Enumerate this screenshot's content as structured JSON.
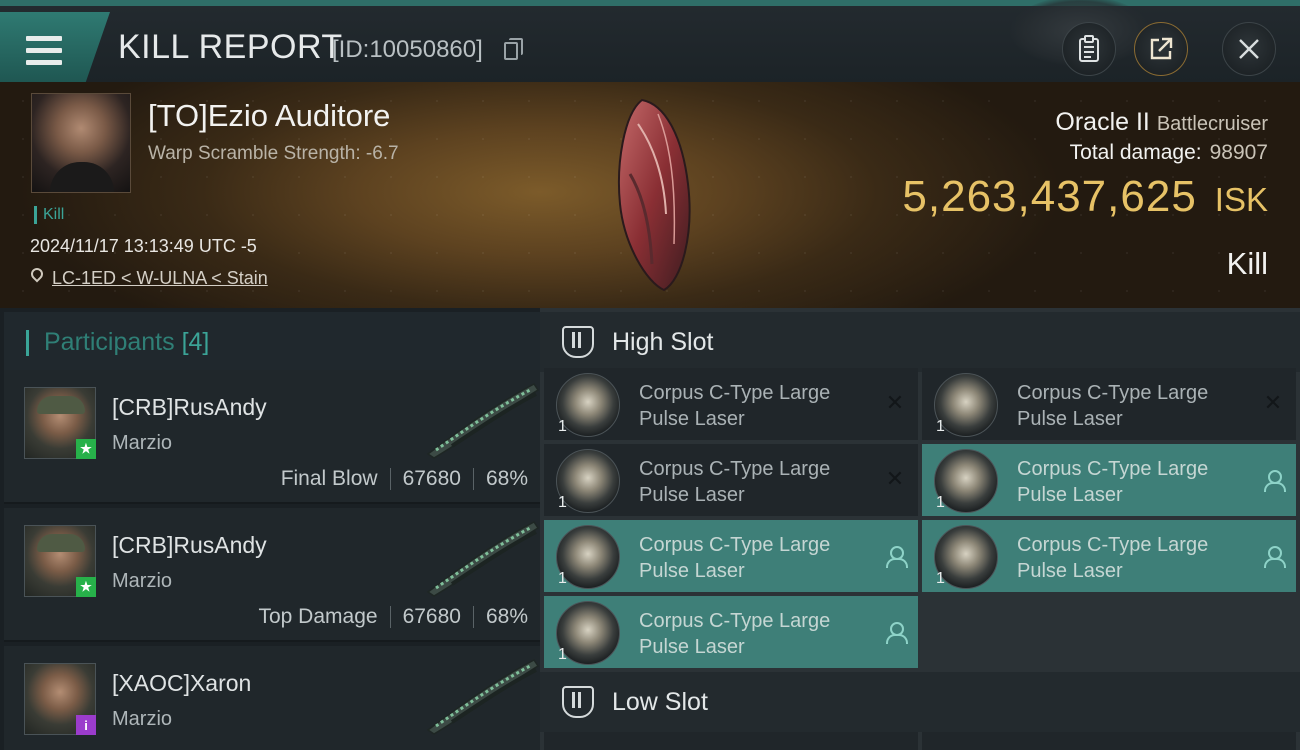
{
  "header": {
    "title": "KILL REPORT",
    "report_id": "[ID:10050860]"
  },
  "victim": {
    "name": "[TO]Ezio Auditore",
    "subtitle": "Warp Scramble Strength: -6.7",
    "tag": "Kill",
    "time": "2024/11/17 13:13:49 UTC -5",
    "location": "LC-1ED < W-ULNA < Stain",
    "ship_name": "Oracle II",
    "ship_class": "Battlecruiser",
    "total_damage_label": "Total damage:",
    "total_damage": "98907",
    "isk_value": "5,263,437,625",
    "isk_unit": "ISK",
    "result": "Kill"
  },
  "participants": {
    "title": "Participants",
    "count": "[4]",
    "items": [
      {
        "name": "[CRB]RusAndy",
        "corp": "Marzio",
        "role": "Final Blow",
        "damage": "67680",
        "percent": "68%",
        "badge": "★",
        "badge_color": "#27b14a"
      },
      {
        "name": "[CRB]RusAndy",
        "corp": "Marzio",
        "role": "Top Damage",
        "damage": "67680",
        "percent": "68%",
        "badge": "★",
        "badge_color": "#27b14a"
      },
      {
        "name": "[XAOC]Xaron",
        "corp": "Marzio",
        "role": "",
        "damage": "",
        "percent": "",
        "badge": "i",
        "badge_color": "#9b3ccc"
      }
    ]
  },
  "fitting": {
    "high_slot_label": "High Slot",
    "low_slot_label": "Low Slot",
    "high_modules": [
      {
        "name": "Corpus C-Type Large Pulse Laser",
        "qty": "1",
        "state": "destroyed"
      },
      {
        "name": "Corpus C-Type Large Pulse Laser",
        "qty": "1",
        "state": "destroyed"
      },
      {
        "name": "Corpus C-Type Large Pulse Laser",
        "qty": "1",
        "state": "destroyed"
      },
      {
        "name": "Corpus C-Type Large Pulse Laser",
        "qty": "1",
        "state": "dropped"
      },
      {
        "name": "Corpus C-Type Large Pulse Laser",
        "qty": "1",
        "state": "dropped"
      },
      {
        "name": "Corpus C-Type Large Pulse Laser",
        "qty": "1",
        "state": "dropped"
      },
      {
        "name": "Corpus C-Type Large Pulse Laser",
        "qty": "1",
        "state": "dropped"
      }
    ]
  },
  "colors": {
    "accent": "#3ba497",
    "isk": "#e7c266",
    "module_dropped": "#3e7f78"
  }
}
